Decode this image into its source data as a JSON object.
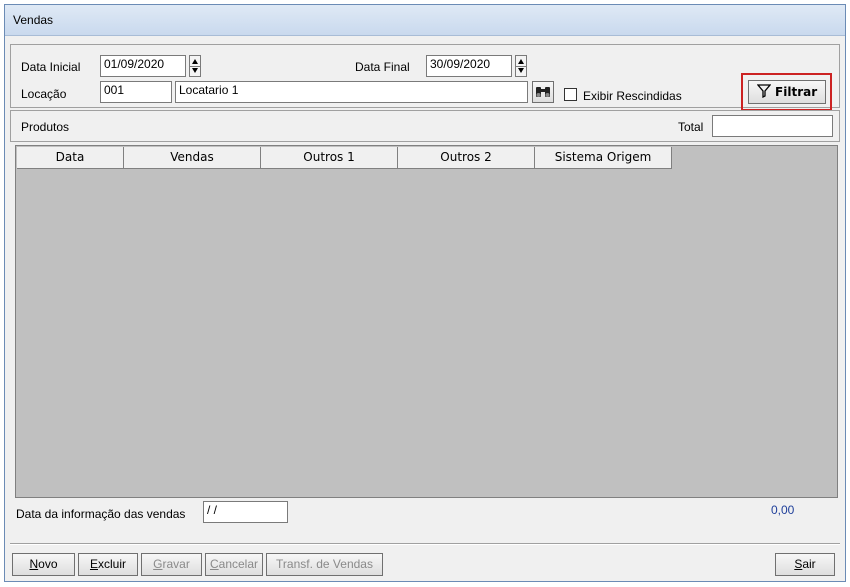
{
  "window": {
    "title": "Vendas"
  },
  "filter": {
    "data_inicial_label": "Data Inicial",
    "data_inicial_value": "01/09/2020",
    "data_final_label": "Data Final",
    "data_final_value": "30/09/2020",
    "locacao_label": "Locação",
    "locacao_code": "001",
    "locacao_name": "Locatario 1",
    "exibir_rescindidas_label": "Exibir Rescindidas",
    "exibir_rescindidas_checked": false,
    "filtrar_label": "Filtrar"
  },
  "produtos": {
    "label": "Produtos",
    "total_label": "Total",
    "total_value": ""
  },
  "grid": {
    "columns": [
      "Data",
      "Vendas",
      "Outros 1",
      "Outros 2",
      "Sistema Origem"
    ],
    "rows": []
  },
  "footer": {
    "data_info_label": "Data da informação das vendas",
    "data_info_value": " / /",
    "total_value": "0,00"
  },
  "buttons": {
    "novo_pre": "",
    "novo_u": "N",
    "novo_post": "ovo",
    "excluir_pre": "",
    "excluir_u": "E",
    "excluir_post": "xcluir",
    "gravar_pre": "",
    "gravar_u": "G",
    "gravar_post": "ravar",
    "cancelar_pre": "",
    "cancelar_u": "C",
    "cancelar_post": "ancelar",
    "transf": "Transf. de Vendas",
    "sair_pre": "",
    "sair_u": "S",
    "sair_post": "air"
  },
  "colors": {
    "highlight_border": "#cc2222",
    "grid_bg": "#c0c0c0",
    "value_blue": "#1f3f9a"
  }
}
